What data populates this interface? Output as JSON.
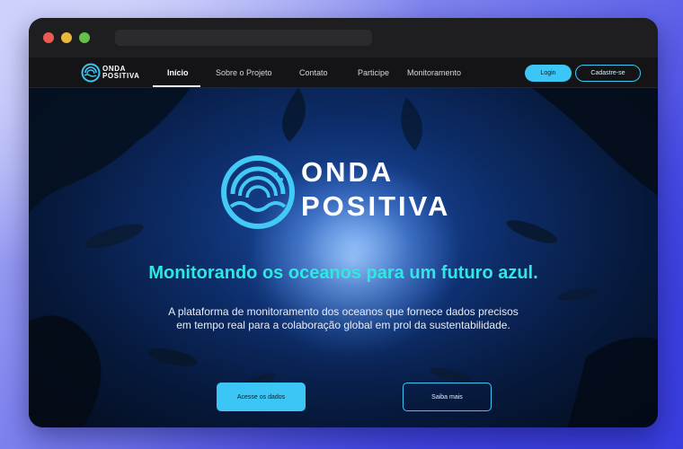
{
  "brand": {
    "name_line1": "ONDA",
    "name_line2": "POSITIVA"
  },
  "nav": {
    "items": [
      {
        "label": "Início",
        "active": true
      },
      {
        "label": "Sobre o Projeto",
        "active": false
      },
      {
        "label": "Contato",
        "active": false
      },
      {
        "label": "Participe",
        "active": false
      },
      {
        "label": "Monitoramento",
        "active": false
      }
    ],
    "login_label": "Login",
    "signup_label": "Cadastre-se"
  },
  "hero": {
    "tagline": "Monitorando os oceanos para um futuro azul.",
    "description": "A plataforma de monitoramento dos oceanos que fornece dados precisos em tempo real para a colaboração global em prol da sustentabilidade.",
    "primary_cta": "Acesse os dados",
    "secondary_cta": "Saiba mais"
  },
  "colors": {
    "accent": "#3cc6f6",
    "tagline": "#2ee8e2",
    "nav_bg": "#141416"
  },
  "icons": [
    "close-dot",
    "minimize-dot",
    "maximize-dot",
    "wave-logo-icon"
  ]
}
